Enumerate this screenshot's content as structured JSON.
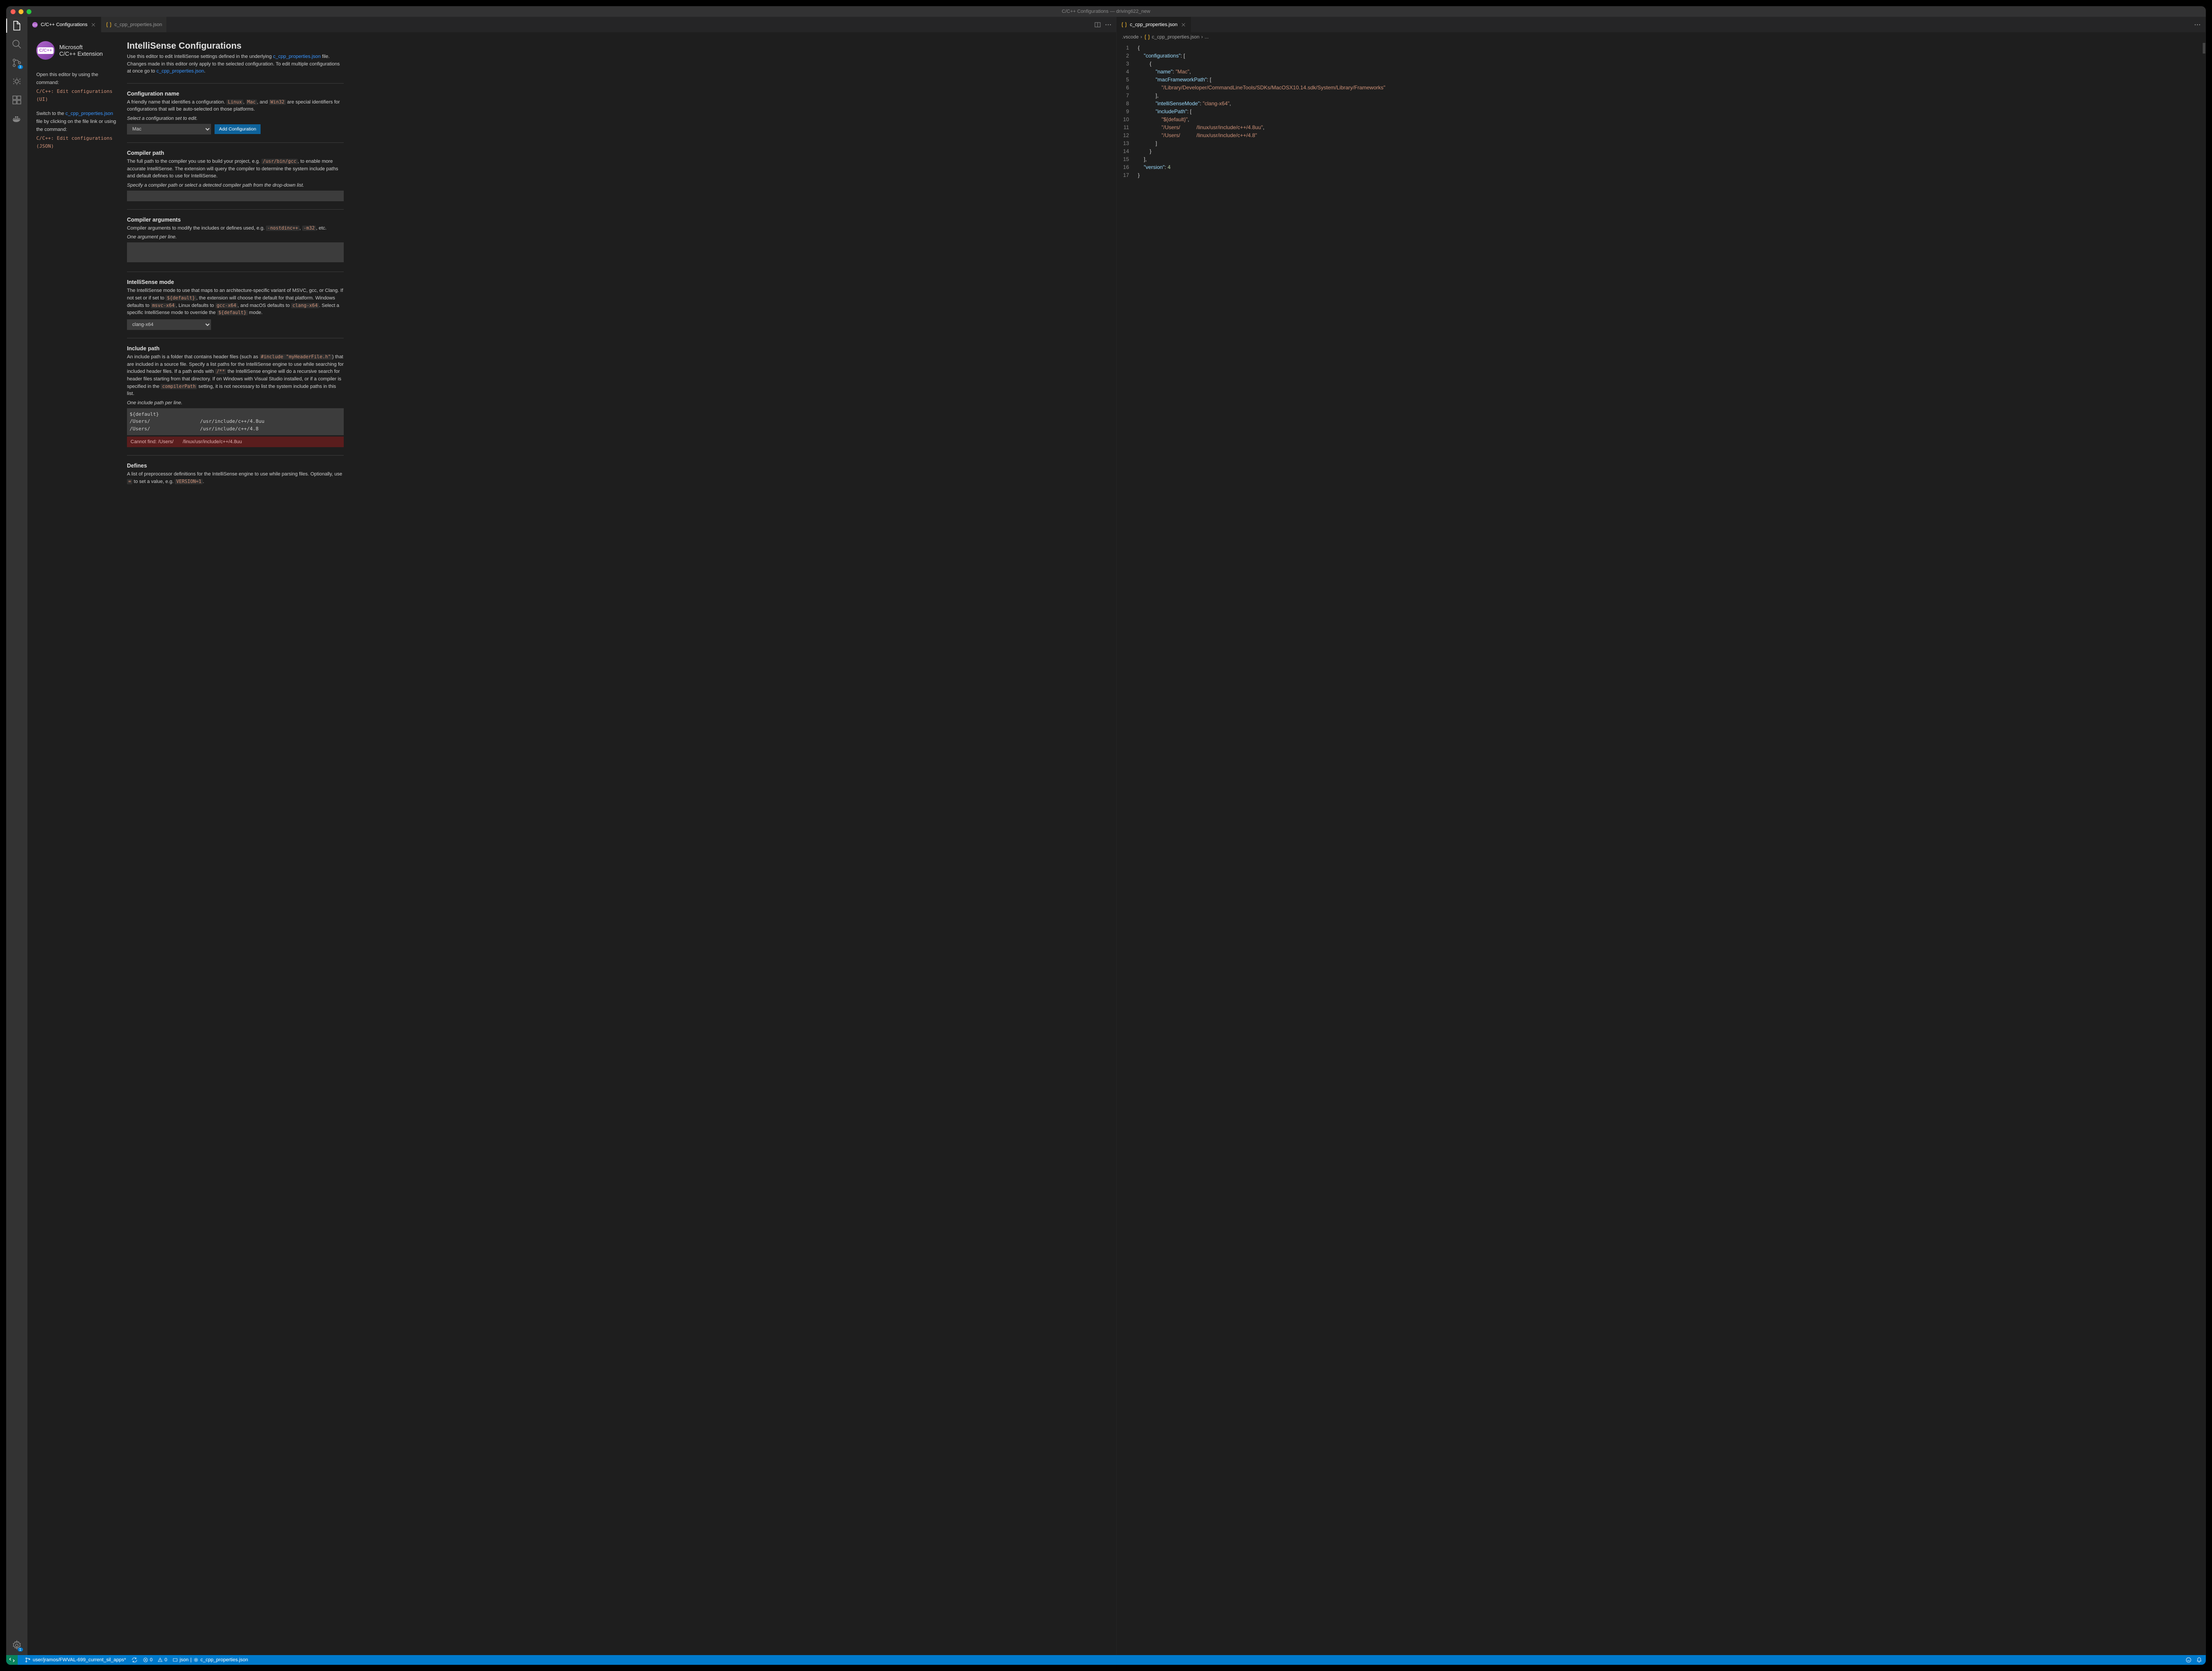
{
  "window_title": "C/C++ Configurations — driving622_new",
  "tabs_left": [
    {
      "label": "C/C++ Configurations",
      "active": true
    },
    {
      "label": "c_cpp_properties.json",
      "active": false
    }
  ],
  "tabs_right": [
    {
      "label": "c_cpp_properties.json",
      "active": true
    }
  ],
  "breadcrumbs": {
    "folder": ".vscode",
    "file": "c_cpp_properties.json",
    "rest": "..."
  },
  "logo": {
    "line1": "Microsoft",
    "line2": "C/C++ Extension",
    "badge": "C/C++"
  },
  "side": {
    "open_text": "Open this editor by using the command:",
    "open_cmd": "C/C++: Edit configurations (UI)",
    "switch_text_a": "Switch to the ",
    "switch_link": "c_cpp_properties.json",
    "switch_text_b": " file by clicking on the file link or using the command:",
    "switch_cmd": "C/C++: Edit configurations (JSON)"
  },
  "page": {
    "title": "IntelliSense Configurations",
    "intro_a": "Use this editor to edit IntelliSense settings defined in the underlying ",
    "intro_link1": "c_cpp_properties.json",
    "intro_b": " file. Changes made in this editor only apply to the selected configuration. To edit multiple configurations at once go to ",
    "intro_link2": "c_cpp_properties.json",
    "intro_c": "."
  },
  "cfgname": {
    "h": "Configuration name",
    "p_a": "A friendly name that identifies a configuration. ",
    "p_b": ", ",
    "p_c": ", and ",
    "p_d": " are special identifiers for configurations that will be auto-selected on those platforms.",
    "c1": "Linux",
    "c2": "Mac",
    "c3": "Win32",
    "hint": "Select a configuration set to edit.",
    "value": "Mac",
    "btn": "Add Configuration"
  },
  "compiler": {
    "h": "Compiler path",
    "p_a": "The full path to the compiler you use to build your project, e.g. ",
    "code": "/usr/bin/gcc",
    "p_b": ", to enable more accurate IntelliSense. The extension will query the compiler to determine the system include paths and default defines to use for IntelliSense.",
    "hint": "Specify a compiler path or select a detected compiler path from the drop-down list.",
    "value": ""
  },
  "args": {
    "h": "Compiler arguments",
    "p_a": "Compiler arguments to modify the includes or defines used, e.g. ",
    "c1": "-nostdinc++",
    "c2": "-m32",
    "p_b": ", ",
    "p_c": ", etc.",
    "hint": "One argument per line.",
    "value": ""
  },
  "mode": {
    "h": "IntelliSense mode",
    "p_a": "The IntelliSense mode to use that maps to an architecture-specific variant of MSVC, gcc, or Clang. If not set or if set to ",
    "c1": "${default}",
    "p_b": ", the extension will choose the default for that platform. Windows defaults to ",
    "c2": "msvc-x64",
    "p_c": ", Linux defaults to ",
    "c3": "gcc-x64",
    "p_d": ", and macOS defaults to ",
    "c4": "clang-x64",
    "p_e": ". Select a specific IntelliSense mode to override the ",
    "c5": "${default}",
    "p_f": " mode.",
    "value": "clang-x64"
  },
  "include": {
    "h": "Include path",
    "p_a": "An include path is a folder that contains header files (such as ",
    "c1": "#include \"myHeaderFile.h\"",
    "p_b": ") that are included in a source file. Specify a list paths for the IntelliSense engine to use while searching for included header files. If a path ends with ",
    "c2": "/**",
    "p_c": " the IntelliSense engine will do a recursive search for header files starting from that directory. If on Windows with Visual Studio installed, or if a compiler is specified in the ",
    "c3": "compilerPath",
    "p_d": " setting, it is not necessary to list the system include paths in this list.",
    "hint": "One include path per line.",
    "value": "${default}\n/Users/                 /usr/include/c++/4.8uu\n/Users/                 /usr/include/c++/4.8",
    "err_label": "Cannot find: /Users/",
    "err_path": "/linux/usr/include/c++/4.8uu"
  },
  "defines": {
    "h": "Defines",
    "p_a": "A list of preprocessor definitions for the IntelliSense engine to use while parsing files. Optionally, use ",
    "c1": "=",
    "p_b": " to set a value, e.g. ",
    "c2": "VERSION=1",
    "p_c": "."
  },
  "json_lines": [
    "{",
    "    \"configurations\": [",
    "        {",
    "            \"name\": \"Mac\",",
    "            \"macFrameworkPath\": [",
    "                \"/Library/Developer/CommandLineTools/SDKs/MacOSX10.14.sdk/System/Library/Frameworks\"",
    "            ],",
    "            \"intelliSenseMode\": \"clang-x64\",",
    "            \"includePath\": [",
    "                \"${default}\",",
    "                \"/Users/           /linux/usr/include/c++/4.8uu\",",
    "                \"/Users/           /linux/usr/include/c++/4.8\"",
    "            ]",
    "        }",
    "    ],",
    "    \"version\": 4",
    "}"
  ],
  "status": {
    "branch": "user/jramos/FWVAL-699_current_sil_apps*",
    "errors": "0",
    "warnings": "0",
    "lang": "json",
    "scope": "c_cpp_properties.json",
    "scm_badge": "3",
    "gear_badge": "1"
  }
}
